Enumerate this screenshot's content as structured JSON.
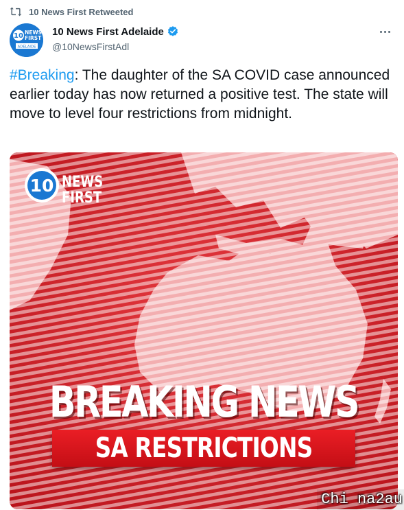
{
  "retweet": {
    "label": "10 News First Retweeted",
    "icon": "retweet-icon"
  },
  "author": {
    "display_name": "10 News First Adelaide",
    "handle": "@10NewsFirstAdl",
    "verified": true,
    "avatar_text": [
      "10",
      "NEWS",
      "FIRST",
      "ADELAIDE"
    ]
  },
  "tweet": {
    "hashtag": "#Breaking",
    "text": ": The daughter of the SA COVID case announced earlier today has now returned a positive test. The state will move to level four restrictions from midnight."
  },
  "media": {
    "logo_number": "10",
    "logo_line1": "NEWS",
    "logo_line2": "FIRST",
    "headline": "BREAKING NEWS",
    "subheadline": "SA RESTRICTIONS"
  },
  "watermark": "Chi na2au",
  "colors": {
    "link": "#1d9bf0",
    "verified": "#1d9bf0",
    "secondary_text": "#536471",
    "media_red": "#d71920",
    "bar_red": "#e3161e",
    "avatar_blue": "#1a78d2"
  }
}
